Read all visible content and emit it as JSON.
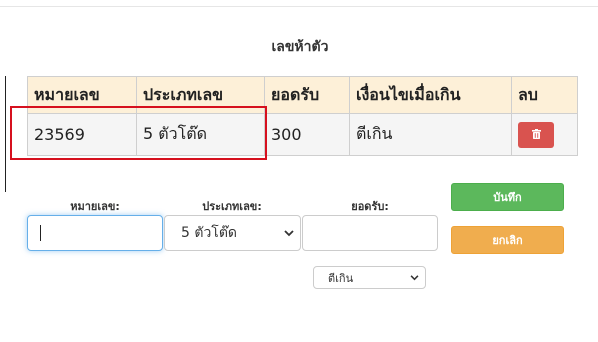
{
  "section": {
    "title": "เลขห้าตัว"
  },
  "table": {
    "headers": [
      "หมายเลข",
      "ประเภทเลข",
      "ยอดรับ",
      "เงื่อนไขเมื่อเกิน",
      "ลบ"
    ],
    "rows": [
      {
        "number": "23569",
        "type": "5 ตัวโต๊ด",
        "amount": "300",
        "condition": "ตีเกิน",
        "delete_icon": "trash-icon"
      }
    ]
  },
  "form": {
    "number_label": "หมายเลข:",
    "number_value": "",
    "type_label": "ประเภทเลข:",
    "type_selected": "5 ตัวโต๊ด",
    "amount_label": "ยอดรับ:",
    "amount_value": "",
    "condition_selected": "ตีเกิน"
  },
  "buttons": {
    "save_label": "บันทึก",
    "cancel_label": "ยกเลิก"
  },
  "colors": {
    "header_bg": "#fdf0d8",
    "delete_red": "#d9534f",
    "save_green": "#5cb85c",
    "cancel_orange": "#f0ad4e",
    "highlight_red": "#d6101e",
    "focus_blue": "#66afe9"
  }
}
